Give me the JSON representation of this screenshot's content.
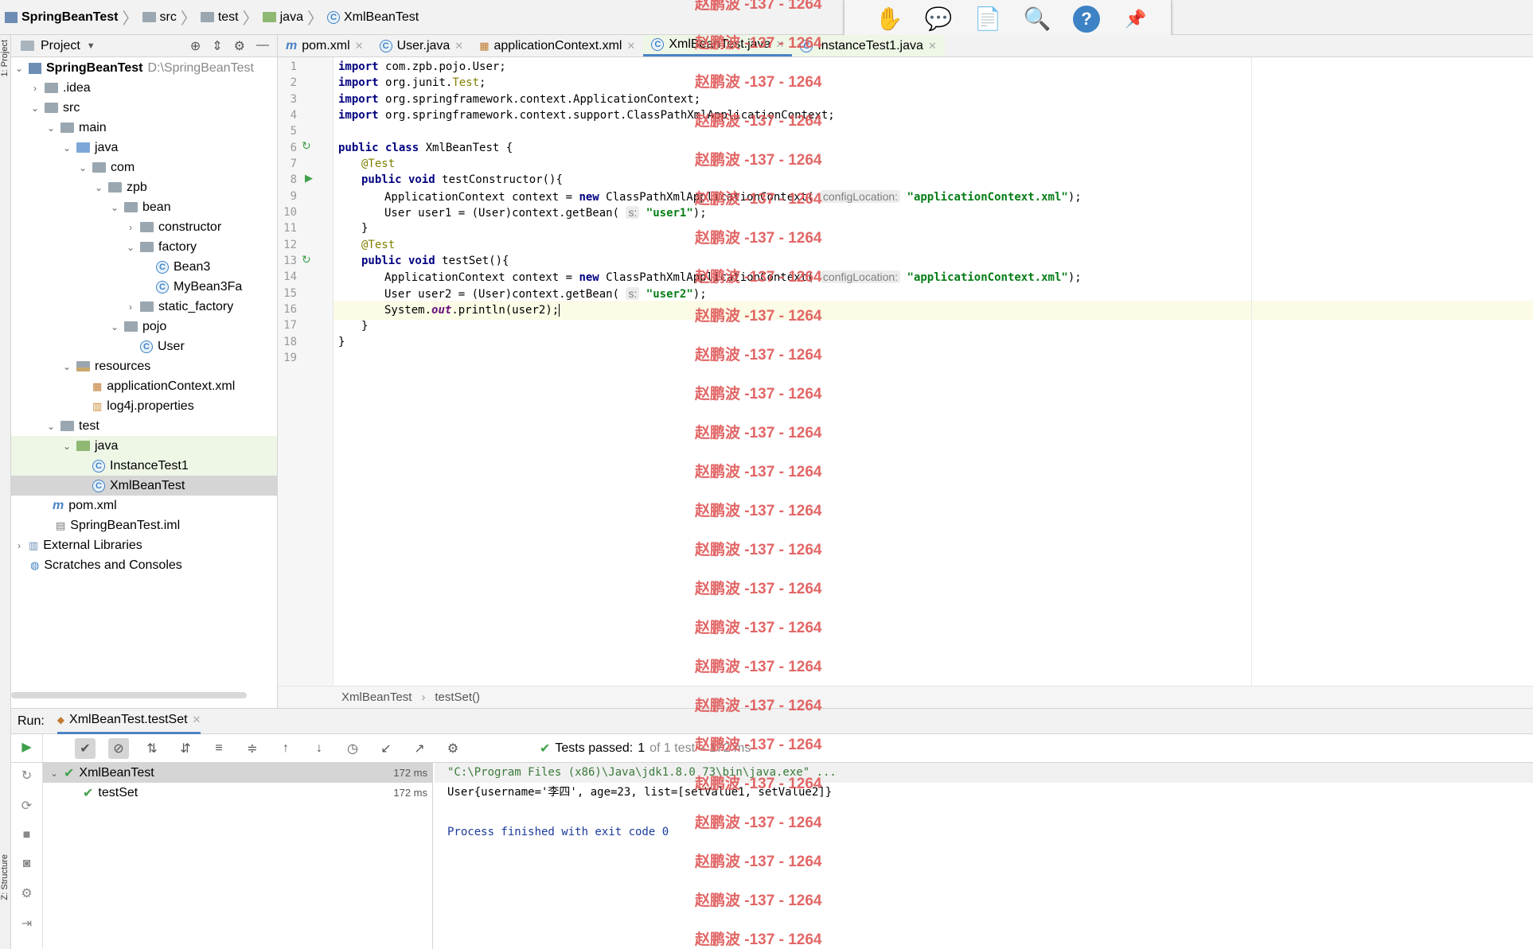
{
  "navbar": {
    "project": "SpringBeanTest",
    "items": [
      "src",
      "test",
      "java",
      "XmlBeanTest"
    ]
  },
  "toolbar_icons": [
    "hand-icon",
    "comment-icon",
    "document-icon",
    "zoom-icon",
    "help-icon",
    "pin-icon"
  ],
  "project_panel": {
    "title": "Project",
    "root": "SpringBeanTest",
    "root_path": "D:\\SpringBeanTest",
    "nodes": [
      ".idea",
      "src",
      "main",
      "java",
      "com",
      "zpb",
      "bean",
      "constructor",
      "factory",
      "Bean3",
      "MyBean3Fa",
      "static_factory",
      "pojo",
      "User",
      "resources",
      "applicationContext.xml",
      "log4j.properties",
      "test",
      "java",
      "InstanceTest1",
      "XmlBeanTest",
      "pom.xml",
      "SpringBeanTest.iml",
      "External Libraries",
      "Scratches and Consoles"
    ]
  },
  "side_labels": {
    "project": "1: Project",
    "structure": "Z: Structure"
  },
  "tabs": [
    "pom.xml",
    "User.java",
    "applicationContext.xml",
    "XmlBeanTest.java",
    "InstanceTest1.java"
  ],
  "code": {
    "lines": [
      "1",
      "2",
      "3",
      "4",
      "5",
      "6",
      "7",
      "8",
      "9",
      "10",
      "11",
      "12",
      "13",
      "14",
      "15",
      "16",
      "17",
      "18",
      "19"
    ],
    "import_kw": "import",
    "imports": [
      "com.zpb.pojo.User;",
      "org.junit.",
      "org.springframework.context.ApplicationContext;",
      "org.springframework.context.support.ClassPathXmlApplicationContext;"
    ],
    "test_name": "Test",
    "semicolon": ";",
    "public_class": "public class",
    "class_name": "XmlBeanTest {",
    "annotation": "@Test",
    "public_void": "public void",
    "m1": "testConstructor(){",
    "ctx_decl": "ApplicationContext context = ",
    "new_kw": "new",
    "ctx_ctor": " ClassPathXmlApplicationContext(",
    "hint_config": "configLocation:",
    "xml_str": "\"applicationContext.xml\"",
    "close_paren": ");",
    "user1_decl": "User user1 = (User)context.getBean(",
    "hint_s": "s:",
    "user1_str": "\"user1\"",
    "close_brace": "}",
    "m2": "testSet(){",
    "user2_decl": "User user2 = (User)context.getBean(",
    "user2_str": "\"user2\"",
    "sys": "System.",
    "out": "out",
    "println": ".println(user2);"
  },
  "editor_breadcrumb": [
    "XmlBeanTest",
    "testSet()"
  ],
  "run": {
    "label": "Run:",
    "config": "XmlBeanTest.testSet",
    "status_prefix": "Tests passed:",
    "passed": "1",
    "status_suffix": "of 1 test – 172 ms",
    "tree": [
      {
        "name": "XmlBeanTest",
        "duration": "172 ms"
      },
      {
        "name": "testSet",
        "duration": "172 ms"
      }
    ],
    "console": [
      "\"C:\\Program Files (x86)\\Java\\jdk1.8.0_73\\bin\\java.exe\" ...",
      "User{username='李四', age=23, list=[setValue1, setValue2]}",
      "",
      "Process finished with exit code 0"
    ]
  },
  "watermark": "赵鹏波 -137 - 1264",
  "colors": {
    "accent": "#4a84c4",
    "pass": "#3fa04a",
    "watermark": "#e05a5a"
  }
}
